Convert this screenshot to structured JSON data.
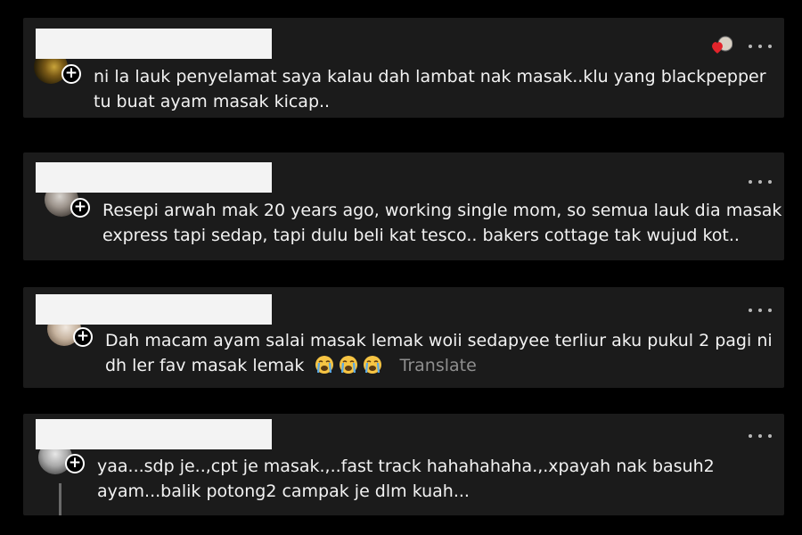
{
  "comments": [
    {
      "lines": [
        "ni la lauk penyelamat saya kalau dah lambat nak masak..klu yang blackpepper",
        "tu buat ayam masak kicap.."
      ]
    },
    {
      "lines": [
        "Resepi arwah mak 20 years ago, working single mom, so semua lauk dia masak",
        "express tapi sedap, tapi dulu beli kat tesco.. bakers cottage tak wujud kot.."
      ]
    },
    {
      "lines": [
        "Dah macam ayam salai masak lemak woii sedapyee terliur aku pukul 2 pagi ni",
        "dh ler fav masak lemak"
      ],
      "emojis": [
        "crying-face",
        "crying-face",
        "crying-face"
      ],
      "translate_label": "Translate"
    },
    {
      "lines": [
        "yaa...sdp je..,cpt je masak.,..fast track hahahahaha.,.xpayah nak basuh2",
        "ayam...balik potong2 campak je dlm kuah..."
      ]
    }
  ],
  "colors": {
    "background": "#000000",
    "card": "#1b1b1b",
    "text": "#f2f2f2",
    "muted": "#8e8e8e",
    "redaction": "#f3f3f3"
  },
  "icons": {
    "more": "more-dots-icon",
    "add": "plus-circle-icon",
    "emoji": "loudly-crying-face-emoji",
    "reaction": "heart-reaction-icon"
  }
}
